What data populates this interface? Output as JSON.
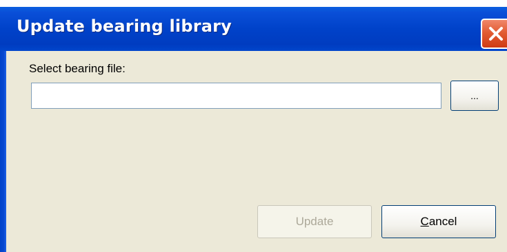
{
  "window": {
    "title": "Update bearing library"
  },
  "form": {
    "file_label": "Select bearing file:",
    "file_value": "",
    "browse_label": "..."
  },
  "buttons": {
    "update_label": "Update",
    "update_enabled": false,
    "cancel_mnemonic": "C",
    "cancel_rest": "ancel"
  },
  "icons": {
    "close": "close-x-icon"
  },
  "colors": {
    "titlebar": "#0042c9",
    "close_button": "#e25c33",
    "client_background": "#ece9d8",
    "input_border": "#7f9db9",
    "button_border": "#003c74",
    "disabled_text": "#aca899"
  }
}
